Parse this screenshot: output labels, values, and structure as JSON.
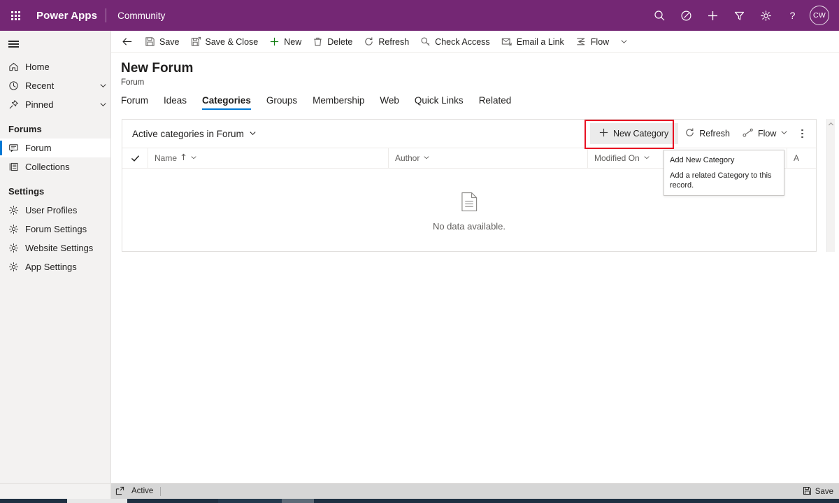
{
  "suite": {
    "waffle_label": "app-launcher",
    "brand": "Power Apps",
    "app_name": "Community",
    "icons": [
      {
        "name": "search-icon",
        "label": "Search"
      },
      {
        "name": "assistant-icon",
        "label": "Assistant"
      },
      {
        "name": "plus-icon",
        "label": "Create"
      },
      {
        "name": "filter-icon",
        "label": "Filter"
      },
      {
        "name": "gear-icon",
        "label": "Settings"
      },
      {
        "name": "help-icon",
        "label": "Help"
      }
    ],
    "avatar_initials": "CW"
  },
  "sidebar": {
    "hamburger_label": "Site Map",
    "items": [
      {
        "label": "Home",
        "icon": "home-icon",
        "chevron": false
      },
      {
        "label": "Recent",
        "icon": "clock-icon",
        "chevron": true
      },
      {
        "label": "Pinned",
        "icon": "pin-icon",
        "chevron": true
      }
    ],
    "groups": [
      {
        "title": "Forums",
        "items": [
          {
            "label": "Forum",
            "icon": "forum-icon",
            "selected": true
          },
          {
            "label": "Collections",
            "icon": "collections-icon",
            "selected": false
          }
        ]
      },
      {
        "title": "Settings",
        "items": [
          {
            "label": "User Profiles",
            "icon": "gear-icon",
            "selected": false
          },
          {
            "label": "Forum Settings",
            "icon": "gear-icon",
            "selected": false
          },
          {
            "label": "Website Settings",
            "icon": "gear-icon",
            "selected": false
          },
          {
            "label": "App Settings",
            "icon": "gear-icon",
            "selected": false
          }
        ]
      }
    ]
  },
  "commandbar": {
    "back_label": "Back",
    "commands": [
      {
        "label": "Save",
        "icon": "save-icon"
      },
      {
        "label": "Save & Close",
        "icon": "save-close-icon"
      },
      {
        "label": "New",
        "icon": "plus-icon"
      },
      {
        "label": "Delete",
        "icon": "trash-icon"
      },
      {
        "label": "Refresh",
        "icon": "refresh-icon"
      },
      {
        "label": "Check Access",
        "icon": "key-icon"
      },
      {
        "label": "Email a Link",
        "icon": "mail-icon"
      },
      {
        "label": "Flow",
        "icon": "flow-icon"
      }
    ]
  },
  "record": {
    "title": "New Forum",
    "subtitle": "Forum",
    "tabs": [
      {
        "label": "Forum",
        "active": false
      },
      {
        "label": "Ideas",
        "active": false
      },
      {
        "label": "Categories",
        "active": true
      },
      {
        "label": "Groups",
        "active": false
      },
      {
        "label": "Membership",
        "active": false
      },
      {
        "label": "Web",
        "active": false
      },
      {
        "label": "Quick Links",
        "active": false
      },
      {
        "label": "Related",
        "active": false
      }
    ]
  },
  "subgrid": {
    "view_name": "Active categories in Forum",
    "actions": [
      {
        "label": "New Category",
        "icon": "plus-icon",
        "highlighted": true
      },
      {
        "label": "Refresh",
        "icon": "refresh-icon",
        "highlighted": false
      },
      {
        "label": "Flow",
        "icon": "flow-icon",
        "highlighted": false
      }
    ],
    "more_label": "More commands",
    "columns": [
      {
        "label": "Name",
        "sorted": true,
        "sort_dir": "ascending"
      },
      {
        "label": "Author",
        "sorted": false
      },
      {
        "label": "Modified On",
        "sorted": false
      },
      {
        "label": "A",
        "sorted": false
      }
    ],
    "empty_message": "No data available."
  },
  "tooltip": {
    "title": "Add New Category",
    "description": "Add a related Category to this record."
  },
  "footer": {
    "expand_label": "Open record set",
    "status": "Active",
    "save_label": "Save"
  },
  "colors": {
    "brand_purple": "#742774",
    "accent_blue": "#0078d4",
    "highlight_red": "#e81123",
    "new_green": "#107c10"
  }
}
